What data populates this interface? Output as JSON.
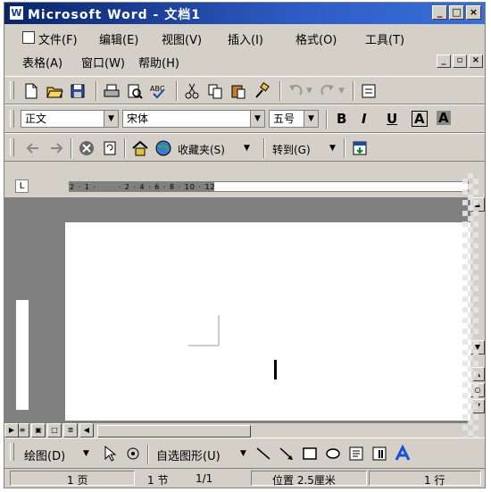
{
  "titlebar": {
    "title": "Microsoft Word - 文档1",
    "icon": "W"
  },
  "menu": {
    "row1": [
      "文件(F)",
      "编辑(E)",
      "视图(V)",
      "插入(I)",
      "格式(O)",
      "工具(T)"
    ],
    "row2": [
      "表格(A)",
      "窗口(W)",
      "帮助(H)"
    ]
  },
  "format": {
    "style": "正文",
    "font": "宋体",
    "size": "五号",
    "bold": "B",
    "italic": "I",
    "underline": "U",
    "char_border": "A",
    "char_shade": "A"
  },
  "web": {
    "favorites": "收藏夹(S)",
    "goto": "转到(G)"
  },
  "ruler": {
    "tab_selector": "L",
    "numbers": "2 · 1 ·       · 2 · 4 · 6 · 8 · 10 · 12"
  },
  "draw": {
    "draw_menu": "绘图(D)",
    "autoshapes": "自选图形(U)"
  },
  "status": {
    "page": "1 页",
    "section": "1 节",
    "pages": "1/1",
    "position": "位置 2.5厘米",
    "line": "1 行"
  },
  "colors": {
    "title_start": "#0a246a",
    "title_end": "#3a6fd8",
    "chrome": "#d4d0c8",
    "workspace": "#808080"
  }
}
